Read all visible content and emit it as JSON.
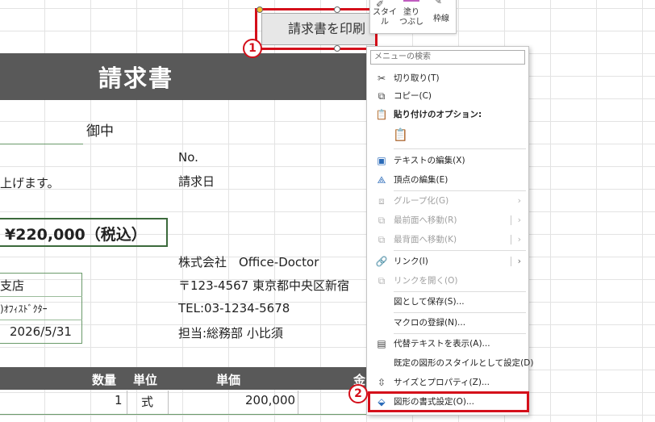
{
  "invoice": {
    "title": "請求書",
    "recipient_suffix": "御中",
    "no_label": "No.",
    "date_label": "請求日",
    "intro_text": "上げます。",
    "total": "¥220,000（税込）",
    "branch": "支店",
    "company_kana": ")ｵﾌｨｽﾄﾞｸﾀｰ",
    "due_date": "2026/5/31",
    "company_name": "株式会社　Office-Doctor",
    "address": "〒123-4567 東京都中央区新宿",
    "tel": "TEL:03-1234-5678",
    "staff": "担当:総務部 小比須",
    "table_headers": [
      "数量",
      "単位",
      "単価",
      "金"
    ],
    "row1": {
      "qty": "1",
      "unit": "式",
      "price": "200,000"
    }
  },
  "shape_button": {
    "label": "請求書を印刷"
  },
  "mini_toolbar": {
    "style": "スタイル",
    "fill": "塗りつぶし",
    "outline": "枠線"
  },
  "callouts": {
    "one": "1",
    "two": "2"
  },
  "context_menu": {
    "search_placeholder": "メニューの検索",
    "items": [
      {
        "label": "切り取り(T)"
      },
      {
        "label": "コピー(C)"
      },
      {
        "label": "貼り付けのオプション:"
      },
      {
        "label": "テキストの編集(X)"
      },
      {
        "label": "頂点の編集(E)"
      },
      {
        "label": "グループ化(G)"
      },
      {
        "label": "最前面へ移動(R)"
      },
      {
        "label": "最背面へ移動(K)"
      },
      {
        "label": "リンク(I)"
      },
      {
        "label": "リンクを開く(O)"
      },
      {
        "label": "図として保存(S)..."
      },
      {
        "label": "マクロの登録(N)..."
      },
      {
        "label": "代替テキストを表示(A)..."
      },
      {
        "label": "既定の図形のスタイルとして設定(D)"
      },
      {
        "label": "サイズとプロパティ(Z)..."
      },
      {
        "label": "図形の書式設定(O)..."
      }
    ]
  },
  "colors": {
    "highlight": "#d40f1a",
    "header_bg": "#595959"
  }
}
